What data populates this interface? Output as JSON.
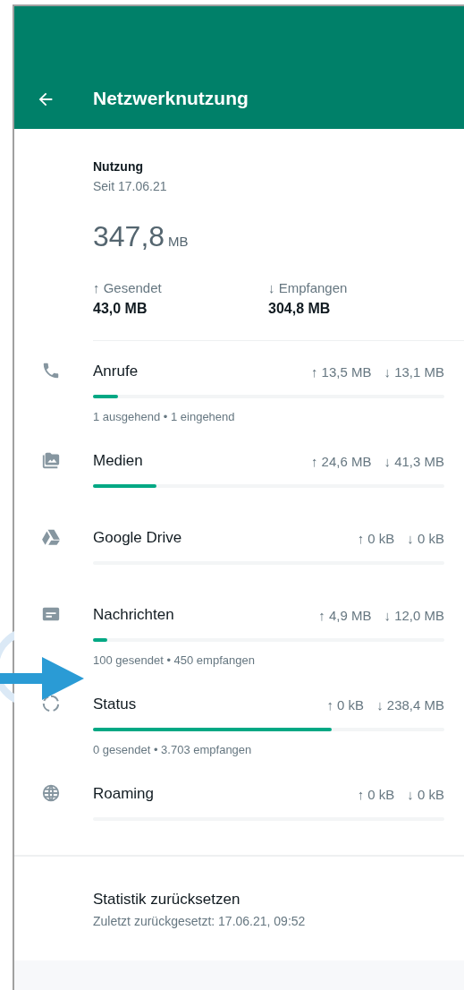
{
  "header": {
    "title": "Netzwerknutzung"
  },
  "summary": {
    "label": "Nutzung",
    "since": "Seit 17.06.21",
    "total": "347,8",
    "total_unit": "MB",
    "sent_label": "↑ Gesendet",
    "sent_value": "43,0 MB",
    "received_label": "↓ Empfangen",
    "received_value": "304,8 MB"
  },
  "categories": [
    {
      "name": "Anrufe",
      "sent": "↑ 13,5 MB",
      "received": "↓ 13,1 MB",
      "level": 0.07,
      "detail": "1 ausgehend • 1 eingehend"
    },
    {
      "name": "Medien",
      "sent": "↑ 24,6 MB",
      "received": "↓ 41,3 MB",
      "level": 0.18
    },
    {
      "name": "Google Drive",
      "sent": "↑ 0 kB",
      "received": "↓ 0 kB"
    },
    {
      "name": "Nachrichten",
      "sent": "↑ 4,9 MB",
      "received": "↓ 12,0 MB",
      "level": 0.04,
      "detail": "100 gesendet • 450 empfangen"
    },
    {
      "name": "Status",
      "sent": "↑ 0 kB",
      "received": "↓ 238,4 MB",
      "level": 0.68,
      "detail": "0 gesendet • 3.703 empfangen"
    },
    {
      "name": "Roaming",
      "sent": "↑ 0 kB",
      "received": "↓ 0 kB"
    }
  ],
  "reset": {
    "title": "Statistik zurücksetzen",
    "subtitle": "Zuletzt zurückgesetzt: 17.06.21, 09:52"
  }
}
